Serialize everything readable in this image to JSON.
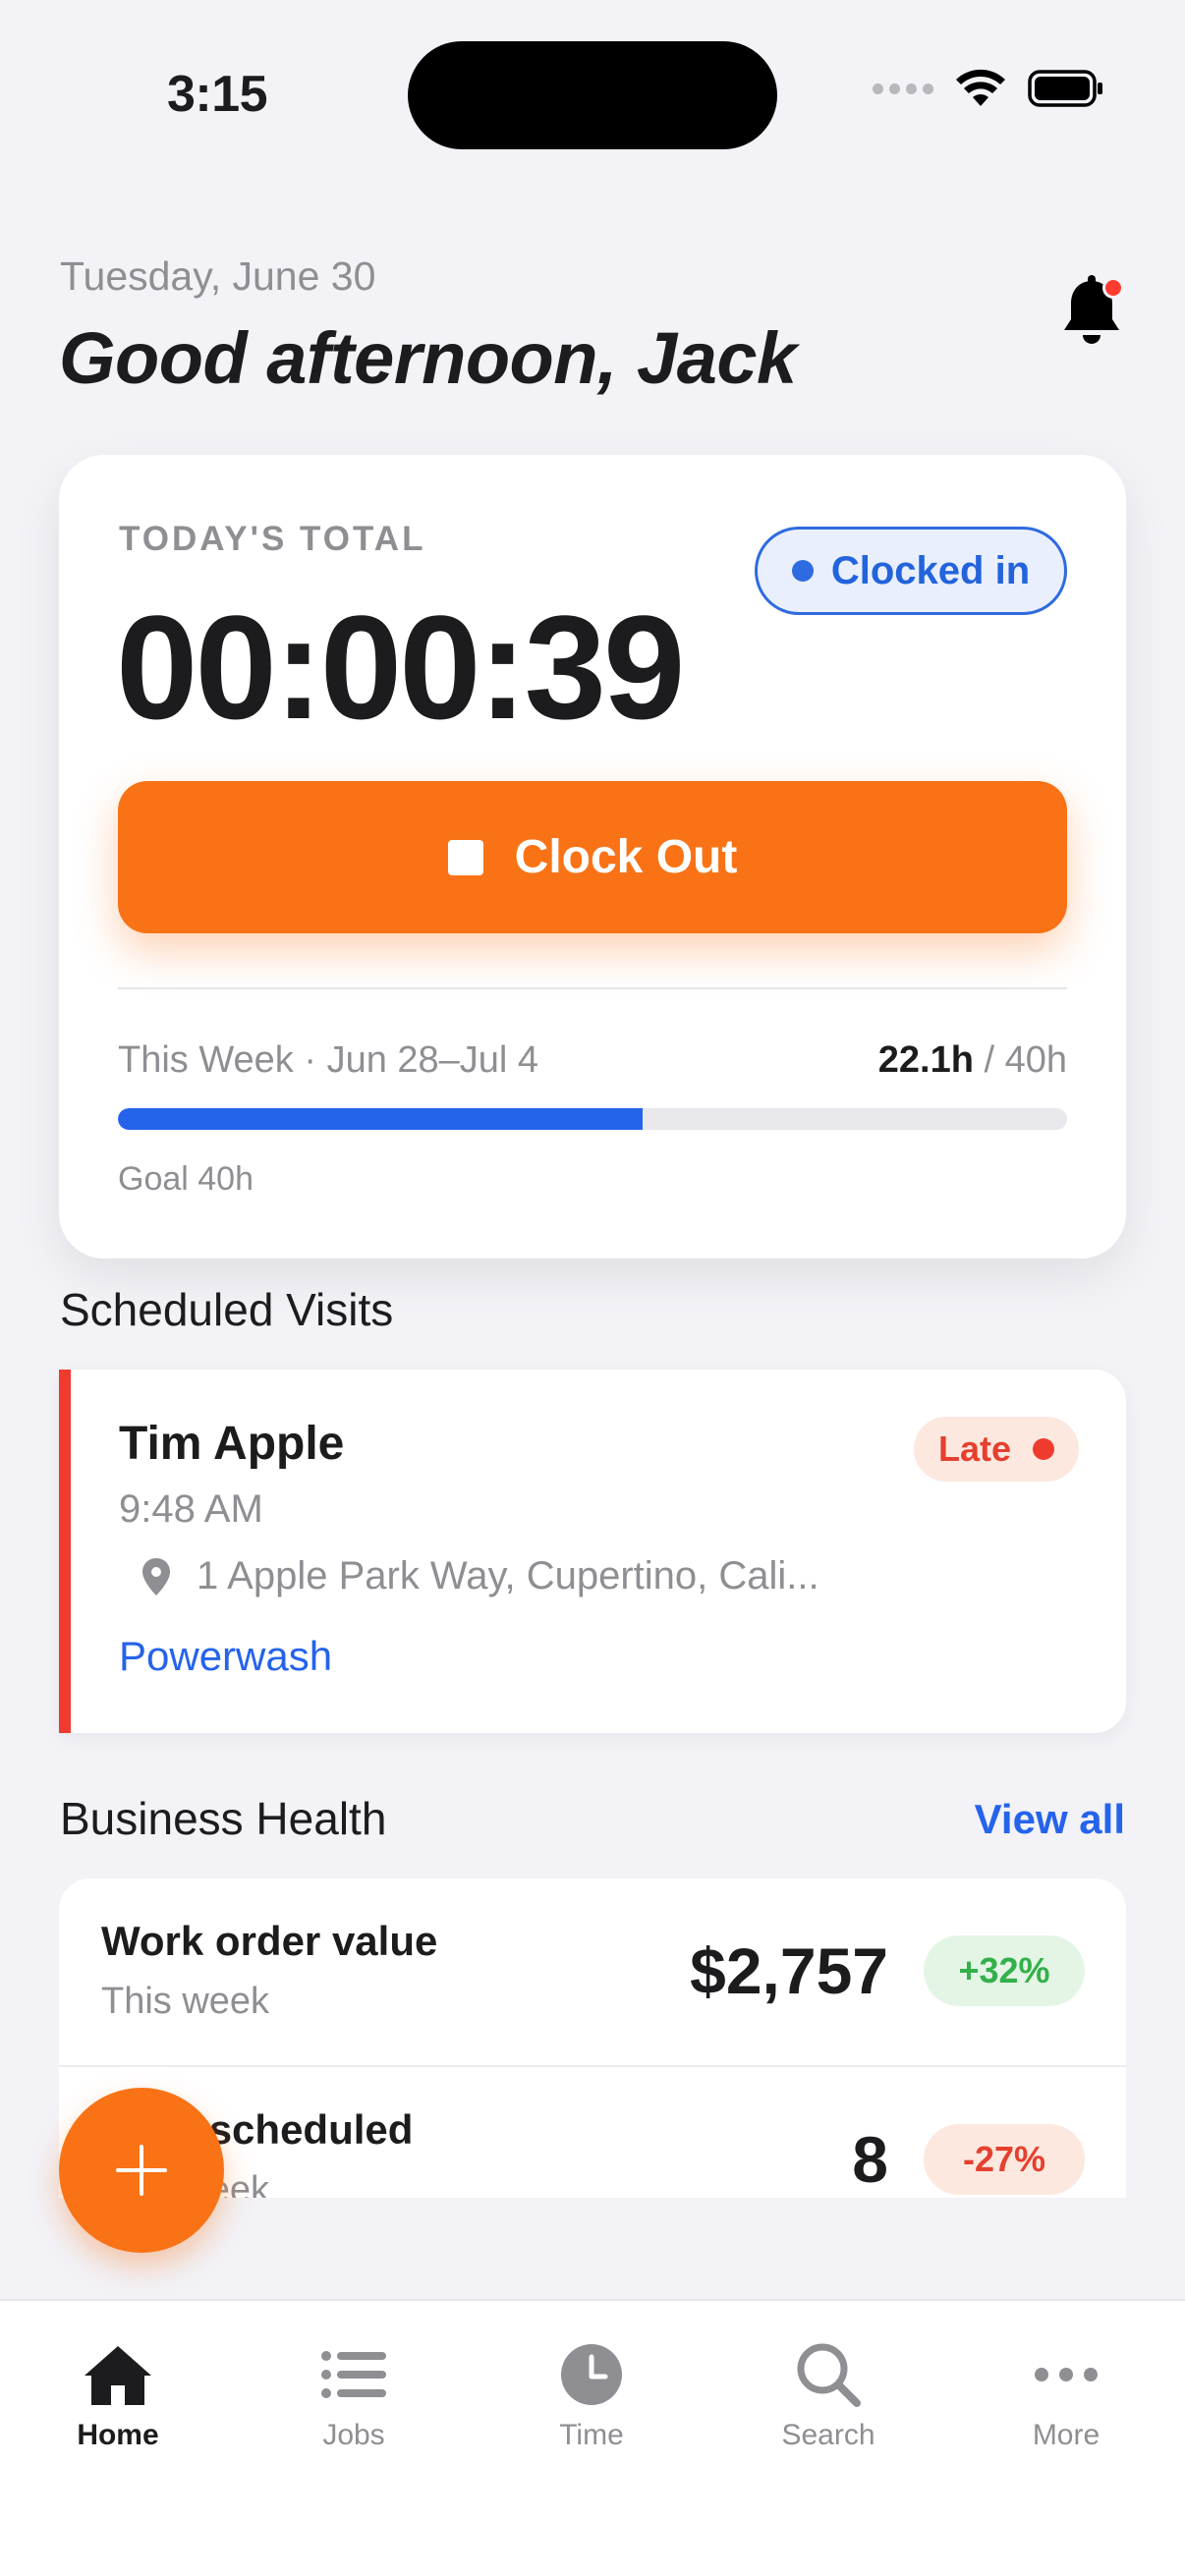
{
  "status_bar": {
    "time": "3:15"
  },
  "header": {
    "date": "Tuesday, June 30",
    "greeting": "Good afternoon, Jack"
  },
  "today": {
    "label": "TODAY'S TOTAL",
    "timer": "00:00:39",
    "status": "Clocked in",
    "clock_out_label": "Clock Out",
    "week_label": "This Week · Jun 28–Jul 4",
    "week_hours": "22.1h",
    "week_goal_hours": " / 40h",
    "week_progress": 0.553,
    "goal_label": "Goal 40h"
  },
  "visits": {
    "title": "Scheduled Visits",
    "items": [
      {
        "name": "Tim Apple",
        "time": "9:48 AM",
        "address": "1 Apple Park Way, Cupertino, Cali...",
        "service": "Powerwash",
        "status": "Late"
      }
    ]
  },
  "health": {
    "title": "Business Health",
    "view_all": "View all",
    "rows": [
      {
        "title": "Work order value",
        "subtitle": "This week",
        "value": "$2,757",
        "delta": "+32%"
      },
      {
        "title": "Jobs scheduled",
        "subtitle": "This week",
        "value": "8",
        "delta": "-27%"
      }
    ]
  },
  "tabs": [
    {
      "label": "Home",
      "icon": "home-icon"
    },
    {
      "label": "Jobs",
      "icon": "list-icon"
    },
    {
      "label": "Time",
      "icon": "clock-icon"
    },
    {
      "label": "Search",
      "icon": "search-icon"
    },
    {
      "label": "More",
      "icon": "more-icon"
    }
  ],
  "colors": {
    "accent": "#f97316",
    "primary": "#2563eb",
    "danger": "#ef3b2f",
    "success": "#34b04a"
  }
}
